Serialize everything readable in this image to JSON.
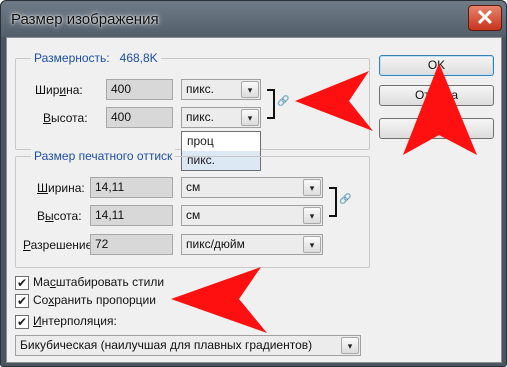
{
  "window": {
    "title": "Размер изображения",
    "close_glyph": "✕"
  },
  "pixel_group": {
    "legend_prefix": "Размерность:",
    "legend_value": "468,8K",
    "width": {
      "label_pre": "Шир",
      "label_u": "и",
      "label_post": "на:",
      "value": "400",
      "unit": "пикс."
    },
    "height": {
      "label_pre": "",
      "label_u": "В",
      "label_post": "ысота:",
      "value": "400",
      "unit": "пикс."
    }
  },
  "unit_dropdown": {
    "options": [
      "проц",
      "пикс."
    ]
  },
  "print_group": {
    "legend": "Размер печатного оттиск",
    "width": {
      "label_pre": "",
      "label_u": "Ш",
      "label_post": "ирина:",
      "value": "14,11",
      "unit": "см"
    },
    "height": {
      "label_pre": "В",
      "label_u": "ы",
      "label_post": "сота:",
      "value": "14,11",
      "unit": "см"
    },
    "resolution": {
      "label_pre": "",
      "label_u": "Р",
      "label_post": "азрешение:",
      "value": "72",
      "unit": "пикс/дюйм"
    }
  },
  "buttons": {
    "ok": "OK",
    "cancel": "Отмена",
    "auto": ""
  },
  "options": {
    "scale_styles": {
      "label_pre": "Ма",
      "label_u": "с",
      "label_post": "штабировать стили",
      "checked": true
    },
    "constrain": {
      "label_pre": "Со",
      "label_u": "х",
      "label_post": "ранить пропорции",
      "checked": true
    },
    "resample": {
      "label_pre": "",
      "label_u": "И",
      "label_post": "нтерполяция:",
      "checked": true
    }
  },
  "resample_method": "Бикубическая (наилучшая для плавных градиентов)",
  "check_glyph": "✔",
  "arrow_glyph": "▾",
  "link_icon_glyph": "🔗",
  "colors": {
    "annotation_arrow": "#ff1010",
    "legend": "#1c4fa3",
    "close": "#c8331b"
  }
}
